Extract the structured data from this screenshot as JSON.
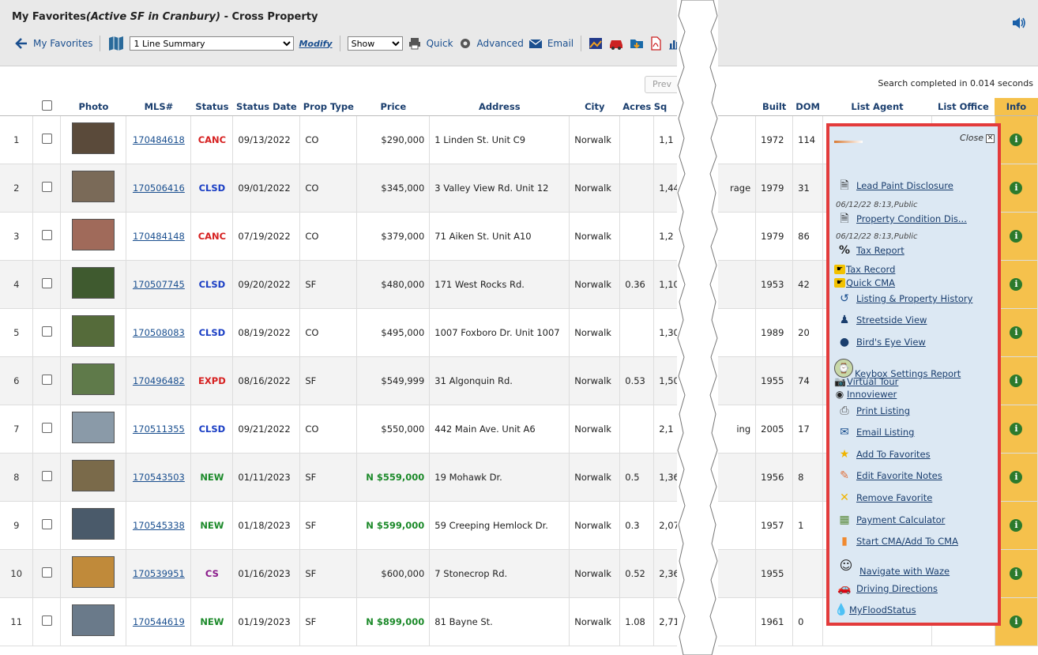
{
  "header": {
    "title_prefix": "My Favorites",
    "title_italic": "(Active SF in Cranbury)",
    "title_suffix": " - Cross Property"
  },
  "toolbar": {
    "back_label": "My Favorites",
    "view_select": "1 Line Summary",
    "modify_label": "Modify",
    "show_select": "Show",
    "quick_label": "Quick",
    "advanced_label": "Advanced",
    "email_label": "Email"
  },
  "search": {
    "prev_label": "Prev",
    "completed_text": "Search completed in 0.014 seconds"
  },
  "table": {
    "headers": {
      "photo": "Photo",
      "mls": "MLS#",
      "status": "Status",
      "status_date": "Status Date",
      "prop_type": "Prop Type",
      "price": "Price",
      "address": "Address",
      "city": "City",
      "acres": "Acres",
      "sq": "Sq",
      "built": "Built",
      "dom": "DOM",
      "list_agent": "List Agent",
      "list_office": "List Office",
      "info": "Info"
    },
    "rows": [
      {
        "num": "1",
        "mls": "170484618",
        "status": "CANC",
        "status_color": "#d62020",
        "date": "09/13/2022",
        "type": "CO",
        "price": "$290,000",
        "price_new": false,
        "address": "1 Linden St. Unit C9",
        "city": "Norwalk",
        "acres": "",
        "sq": "1,1",
        "extra": "",
        "built": "1972",
        "dom": "114",
        "photo_color": "#5a4a3a"
      },
      {
        "num": "2",
        "mls": "170506416",
        "status": "CLSD",
        "status_color": "#1a3ec4",
        "date": "09/01/2022",
        "type": "CO",
        "price": "$345,000",
        "price_new": false,
        "address": "3 Valley View Rd. Unit 12",
        "city": "Norwalk",
        "acres": "",
        "sq": "1,44",
        "extra": "rage",
        "built": "1979",
        "dom": "31",
        "photo_color": "#7a6a58"
      },
      {
        "num": "3",
        "mls": "170484148",
        "status": "CANC",
        "status_color": "#d62020",
        "date": "07/19/2022",
        "type": "CO",
        "price": "$379,000",
        "price_new": false,
        "address": "71 Aiken St. Unit A10",
        "city": "Norwalk",
        "acres": "",
        "sq": "1,2",
        "extra": "",
        "built": "1979",
        "dom": "86",
        "photo_color": "#a06a5a"
      },
      {
        "num": "4",
        "mls": "170507745",
        "status": "CLSD",
        "status_color": "#1a3ec4",
        "date": "09/20/2022",
        "type": "SF",
        "price": "$480,000",
        "price_new": false,
        "address": "171 West Rocks Rd.",
        "city": "Norwalk",
        "acres": "0.36",
        "sq": "1,10",
        "extra": "",
        "built": "1953",
        "dom": "42",
        "photo_color": "#3f5a2f"
      },
      {
        "num": "5",
        "mls": "170508083",
        "status": "CLSD",
        "status_color": "#1a3ec4",
        "date": "08/19/2022",
        "type": "CO",
        "price": "$495,000",
        "price_new": false,
        "address": "1007 Foxboro Dr. Unit 1007",
        "city": "Norwalk",
        "acres": "",
        "sq": "1,30",
        "extra": "",
        "built": "1989",
        "dom": "20",
        "photo_color": "#556b3a"
      },
      {
        "num": "6",
        "mls": "170496482",
        "status": "EXPD",
        "status_color": "#d62020",
        "date": "08/16/2022",
        "type": "SF",
        "price": "$549,999",
        "price_new": false,
        "address": "31 Algonquin Rd.",
        "city": "Norwalk",
        "acres": "0.53",
        "sq": "1,50",
        "extra": "",
        "built": "1955",
        "dom": "74",
        "photo_color": "#5f7a4a"
      },
      {
        "num": "7",
        "mls": "170511355",
        "status": "CLSD",
        "status_color": "#1a3ec4",
        "date": "09/21/2022",
        "type": "CO",
        "price": "$550,000",
        "price_new": false,
        "address": "442 Main Ave. Unit A6",
        "city": "Norwalk",
        "acres": "",
        "sq": "2,1",
        "extra": "ing",
        "built": "2005",
        "dom": "17",
        "photo_color": "#8a9aa8"
      },
      {
        "num": "8",
        "mls": "170543503",
        "status": "NEW",
        "status_color": "#1c8a2a",
        "date": "01/11/2023",
        "type": "SF",
        "price": "N $559,000",
        "price_new": true,
        "address": "19 Mohawk Dr.",
        "city": "Norwalk",
        "acres": "0.5",
        "sq": "1,36",
        "extra": "",
        "built": "1956",
        "dom": "8",
        "photo_color": "#7a6a4a"
      },
      {
        "num": "9",
        "mls": "170545338",
        "status": "NEW",
        "status_color": "#1c8a2a",
        "date": "01/18/2023",
        "type": "SF",
        "price": "N $599,000",
        "price_new": true,
        "address": "59 Creeping Hemlock Dr.",
        "city": "Norwalk",
        "acres": "0.3",
        "sq": "2,07",
        "extra": "",
        "built": "1957",
        "dom": "1",
        "photo_color": "#4a5a6a"
      },
      {
        "num": "10",
        "mls": "170539951",
        "status": "CS",
        "status_color": "#8a1a8a",
        "date": "01/16/2023",
        "type": "SF",
        "price": "$600,000",
        "price_new": false,
        "address": "7 Stonecrop Rd.",
        "city": "Norwalk",
        "acres": "0.52",
        "sq": "2,36",
        "extra": "",
        "built": "1955",
        "dom": "",
        "photo_color": "#c08a3a"
      },
      {
        "num": "11",
        "mls": "170544619",
        "status": "NEW",
        "status_color": "#1c8a2a",
        "date": "01/19/2023",
        "type": "SF",
        "price": "N $899,000",
        "price_new": true,
        "address": "81 Bayne St.",
        "city": "Norwalk",
        "acres": "1.08",
        "sq": "2,71",
        "extra": "",
        "built": "1961",
        "dom": "0",
        "photo_color": "#6a7a8a"
      }
    ]
  },
  "popup": {
    "close_label": "Close",
    "items": [
      {
        "label": "Lead Paint Disclosure",
        "icon": "document-icon"
      },
      {
        "label": "Property Condition Dis...",
        "icon": "document-icon"
      },
      {
        "label": "Tax Report",
        "icon": "percent-icon"
      },
      {
        "label": "Tax Record",
        "icon": "pointer-icon"
      },
      {
        "label": "Quick CMA",
        "icon": "pointer-icon"
      },
      {
        "label": "Listing & Property History",
        "icon": "history-icon"
      },
      {
        "label": "Streetside View",
        "icon": "person-icon"
      },
      {
        "label": "Bird's Eye View",
        "icon": "globe-icon"
      },
      {
        "label": "Keybox Settings Report",
        "icon": "keybox-icon"
      },
      {
        "label": "Virtual Tour",
        "icon": "camera-icon"
      },
      {
        "label": "Innoviewer",
        "icon": "innoviewer-icon"
      },
      {
        "label": "Print Listing",
        "icon": "printer-icon"
      },
      {
        "label": "Email Listing",
        "icon": "envelope-icon"
      },
      {
        "label": "Add To Favorites",
        "icon": "star-icon"
      },
      {
        "label": "Edit Favorite Notes",
        "icon": "pencil-icon"
      },
      {
        "label": "Remove Favorite",
        "icon": "x-icon"
      },
      {
        "label": "Payment Calculator",
        "icon": "calculator-icon"
      },
      {
        "label": "Start CMA/Add To CMA",
        "icon": "bar-chart-icon"
      },
      {
        "label": "Navigate with Waze",
        "icon": "waze-icon"
      },
      {
        "label": "Driving Directions",
        "icon": "car-icon"
      },
      {
        "label": "MyFloodStatus",
        "icon": "drop-icon"
      }
    ],
    "sub_notes": [
      "06/12/22 8:13,Public",
      "06/12/22 8:13,Public"
    ]
  }
}
